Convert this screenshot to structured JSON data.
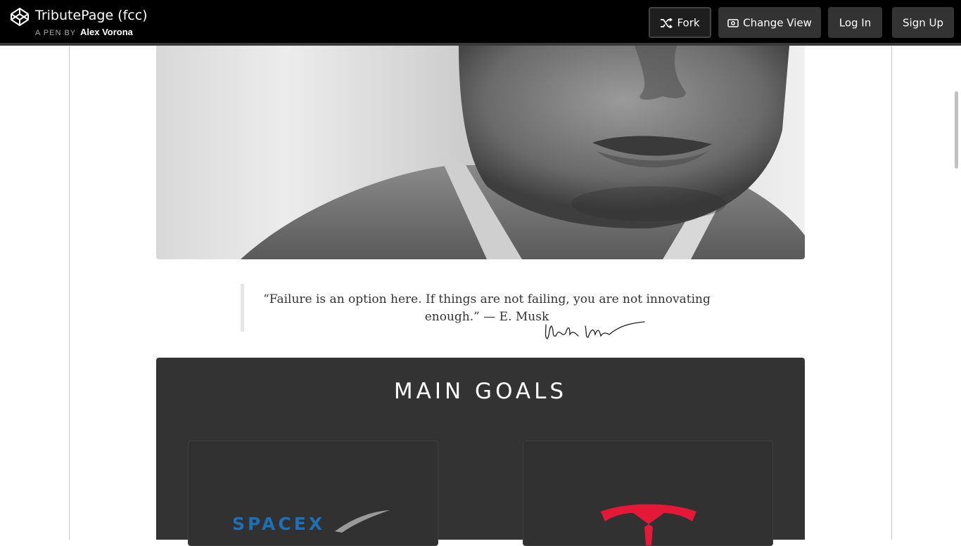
{
  "header": {
    "title": "TributePage (fcc)",
    "by_label": "A PEN BY",
    "author": "Alex Vorona",
    "buttons": {
      "fork": "Fork",
      "change_view": "Change View",
      "log_in": "Log In",
      "sign_up": "Sign Up"
    }
  },
  "hero": {
    "image_alt": "Portrait photo"
  },
  "quote": {
    "line1": "“Failure is an option here. If things are not failing, you are not innovating",
    "line2": "enough.” — E. Musk"
  },
  "goals": {
    "title": "MAIN GOALS",
    "cards": [
      {
        "logo_text": "SPACEX"
      },
      {
        "logo_text": ""
      }
    ]
  },
  "colors": {
    "header_bg": "#000000",
    "button_bg": "#333333",
    "section_bg": "#333333",
    "spacex_blue": "#1e6fb3",
    "tesla_red": "#e31937"
  }
}
